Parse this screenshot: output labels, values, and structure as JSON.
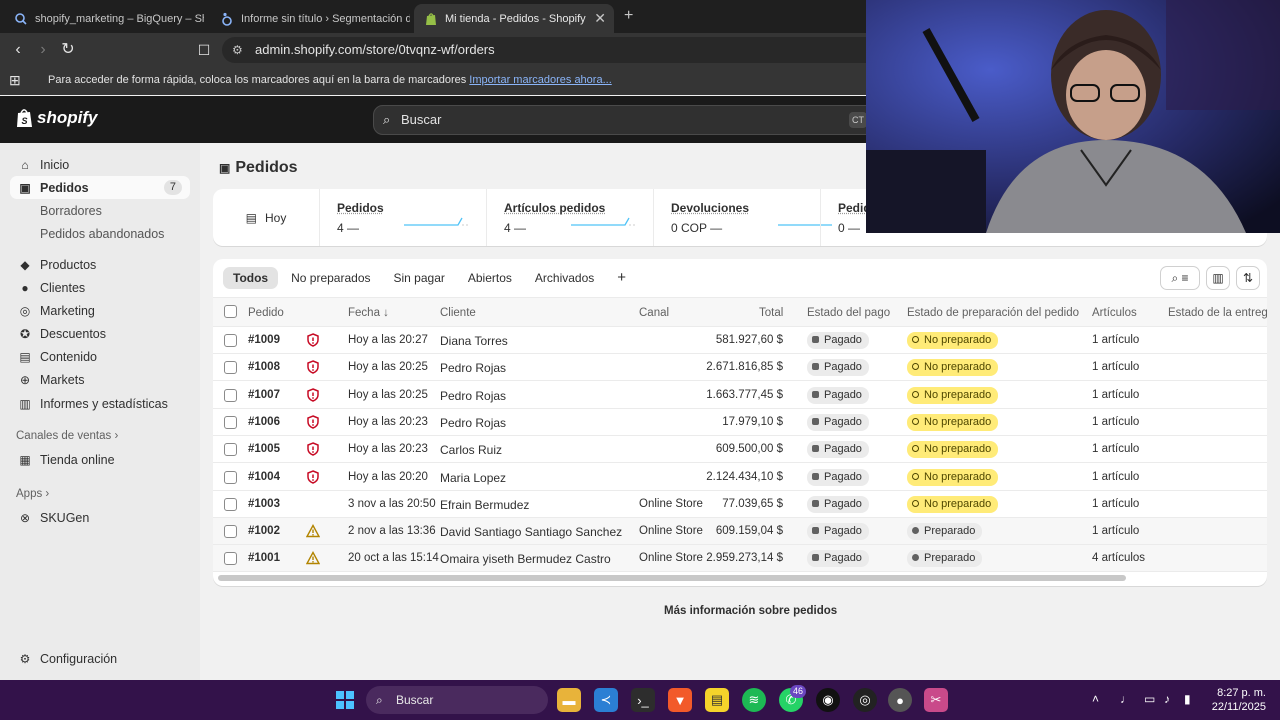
{
  "browser": {
    "tabs": [
      {
        "title": "shopify_marketing – BigQuery – Sho",
        "icon": "bigquery-icon"
      },
      {
        "title": "Informe sin título › Segmentación de",
        "icon": "looker-studio-icon"
      },
      {
        "title": "Mi tienda - Pedidos - Shopify",
        "icon": "shopify-icon",
        "active": true
      }
    ],
    "url": "admin.shopify.com/store/0tvqnz-wf/orders",
    "bookmarks_text": "Para acceder de forma rápida, coloca los marcadores aquí en la barra de marcadores",
    "bookmarks_link": "Importar marcadores ahora..."
  },
  "shopify": {
    "brand": "shopify",
    "search_placeholder": "Buscar",
    "search_shortcut": "CT"
  },
  "sidebar": {
    "items": [
      {
        "label": "Inicio",
        "icon": "home-icon"
      },
      {
        "label": "Pedidos",
        "icon": "orders-icon",
        "badge": "7",
        "active": true
      },
      {
        "label": "Borradores"
      },
      {
        "label": "Pedidos abandonados"
      },
      {
        "label": "Productos",
        "icon": "tag-icon"
      },
      {
        "label": "Clientes",
        "icon": "person-icon"
      },
      {
        "label": "Marketing",
        "icon": "target-icon"
      },
      {
        "label": "Descuentos",
        "icon": "discount-icon"
      },
      {
        "label": "Contenido",
        "icon": "content-icon"
      },
      {
        "label": "Markets",
        "icon": "globe-icon"
      },
      {
        "label": "Informes y estadísticas",
        "icon": "chart-icon"
      }
    ],
    "sales_channels": "Canales de ventas",
    "online_store": "Tienda online",
    "apps": "Apps",
    "skugen": "SKUGen",
    "settings": "Configuración"
  },
  "page": {
    "title": "Pedidos",
    "date_filter": "Hoy",
    "stats": [
      {
        "label": "Pedidos",
        "value": "4",
        "dash": "—"
      },
      {
        "label": "Artículos pedidos",
        "value": "4",
        "dash": "—"
      },
      {
        "label": "Devoluciones",
        "value": "0 COP",
        "dash": "—"
      },
      {
        "label": "Pedid",
        "value": "0",
        "dash": "—"
      }
    ],
    "view_tabs": [
      "Todos",
      "No preparados",
      "Sin pagar",
      "Abiertos",
      "Archivados"
    ],
    "add_view": "+",
    "columns": {
      "order": "Pedido",
      "date": "Fecha",
      "sort_arrow": "↓",
      "customer": "Cliente",
      "channel": "Canal",
      "total": "Total",
      "payment": "Estado del pago",
      "fulfillment": "Estado de preparación del pedido",
      "items": "Artículos",
      "delivery": "Estado de la entrega"
    },
    "orders": [
      {
        "id": "#1009",
        "risk": "high",
        "date": "Hoy a las 20:27",
        "customer": "Diana Torres",
        "channel": "",
        "total": "581.927,60 $",
        "payment": "Pagado",
        "fulfillment": "No preparado",
        "items": "1 artículo"
      },
      {
        "id": "#1008",
        "risk": "high",
        "date": "Hoy a las 20:25",
        "customer": "Pedro Rojas",
        "channel": "",
        "total": "2.671.816,85 $",
        "payment": "Pagado",
        "fulfillment": "No preparado",
        "items": "1 artículo"
      },
      {
        "id": "#1007",
        "risk": "high",
        "date": "Hoy a las 20:25",
        "customer": "Pedro Rojas",
        "channel": "",
        "total": "1.663.777,45 $",
        "payment": "Pagado",
        "fulfillment": "No preparado",
        "items": "1 artículo"
      },
      {
        "id": "#1006",
        "risk": "high",
        "date": "Hoy a las 20:23",
        "customer": "Pedro Rojas",
        "channel": "",
        "total": "17.979,10 $",
        "payment": "Pagado",
        "fulfillment": "No preparado",
        "items": "1 artículo"
      },
      {
        "id": "#1005",
        "risk": "high",
        "date": "Hoy a las 20:23",
        "customer": "Carlos Ruiz",
        "channel": "",
        "total": "609.500,00 $",
        "payment": "Pagado",
        "fulfillment": "No preparado",
        "items": "1 artículo"
      },
      {
        "id": "#1004",
        "risk": "high",
        "date": "Hoy a las 20:20",
        "customer": "Maria Lopez",
        "channel": "",
        "total": "2.124.434,10 $",
        "payment": "Pagado",
        "fulfillment": "No preparado",
        "items": "1 artículo"
      },
      {
        "id": "#1003",
        "risk": "none",
        "date": "3 nov a las 20:50",
        "customer": "Efrain Bermudez",
        "channel": "Online Store",
        "total": "77.039,65 $",
        "payment": "Pagado",
        "fulfillment": "No preparado",
        "items": "1 artículo"
      },
      {
        "id": "#1002",
        "risk": "warn",
        "date": "2 nov a las 13:36",
        "customer": "David Santiago Santiago Sanchez",
        "channel": "Online Store",
        "total": "609.159,04 $",
        "payment": "Pagado",
        "fulfillment": "Preparado",
        "items": "1 artículo"
      },
      {
        "id": "#1001",
        "risk": "warn",
        "date": "20 oct a las 15:14",
        "customer": "Omaira yiseth Bermudez Castro",
        "channel": "Online Store",
        "total": "2.959.273,14 $",
        "payment": "Pagado",
        "fulfillment": "Preparado",
        "items": "4 artículos"
      }
    ],
    "more_info": "Más información sobre pedidos"
  },
  "taskbar": {
    "search": "Buscar",
    "whatsapp_badge": "46",
    "time": "8:27 p. m.",
    "date": "22/11/2025"
  },
  "colors": {
    "shopify_dark": "#1a1a1a",
    "unfulfilled": "#ffeb78",
    "risk_red": "#c70a24",
    "warn_yellow": "#b28400",
    "taskbar": "#33124a"
  }
}
